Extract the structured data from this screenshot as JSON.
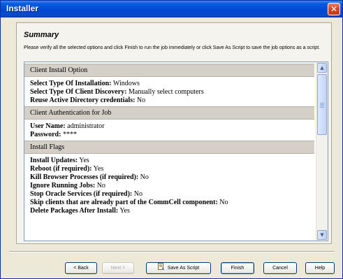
{
  "window": {
    "title": "Installer"
  },
  "summary": {
    "title": "Summary",
    "description": "Please verify all the selected options and click Finish to run the job immediately or click Save As Script to save the job options as a script."
  },
  "sections": [
    {
      "header": "Client Install Option",
      "items": [
        {
          "label": "Select Type Of Installation:",
          "value": "Windows"
        },
        {
          "label": "Select Type Of Client Discovery:",
          "value": "Manually select computers"
        },
        {
          "label": "Reuse Active Directory credentials:",
          "value": "No"
        }
      ]
    },
    {
      "header": "Client Authentication for Job",
      "items": [
        {
          "label": "User Name:",
          "value": "administrator"
        },
        {
          "label": "Password:",
          "value": "****"
        }
      ]
    },
    {
      "header": "Install Flags",
      "items": [
        {
          "label": "Install Updates:",
          "value": "Yes"
        },
        {
          "label": "Reboot (if required):",
          "value": "Yes"
        },
        {
          "label": "Kill Browser Processes (if required):",
          "value": "No"
        },
        {
          "label": "Ignore Running Jobs:",
          "value": "No"
        },
        {
          "label": "Stop Oracle Services (if required):",
          "value": "No"
        },
        {
          "label": "Skip clients that are already part of the CommCell component:",
          "value": "No"
        },
        {
          "label": "Delete Packages After Install:",
          "value": "Yes"
        }
      ]
    }
  ],
  "buttons": {
    "back": "< Back",
    "next": "Next >",
    "save_script": "Save As Script",
    "finish": "Finish",
    "cancel": "Cancel",
    "help": "Help"
  },
  "icons": {
    "close": "close-icon",
    "scroll_up": "arrow-up-icon",
    "scroll_down": "arrow-down-icon",
    "save_script": "script-icon"
  }
}
